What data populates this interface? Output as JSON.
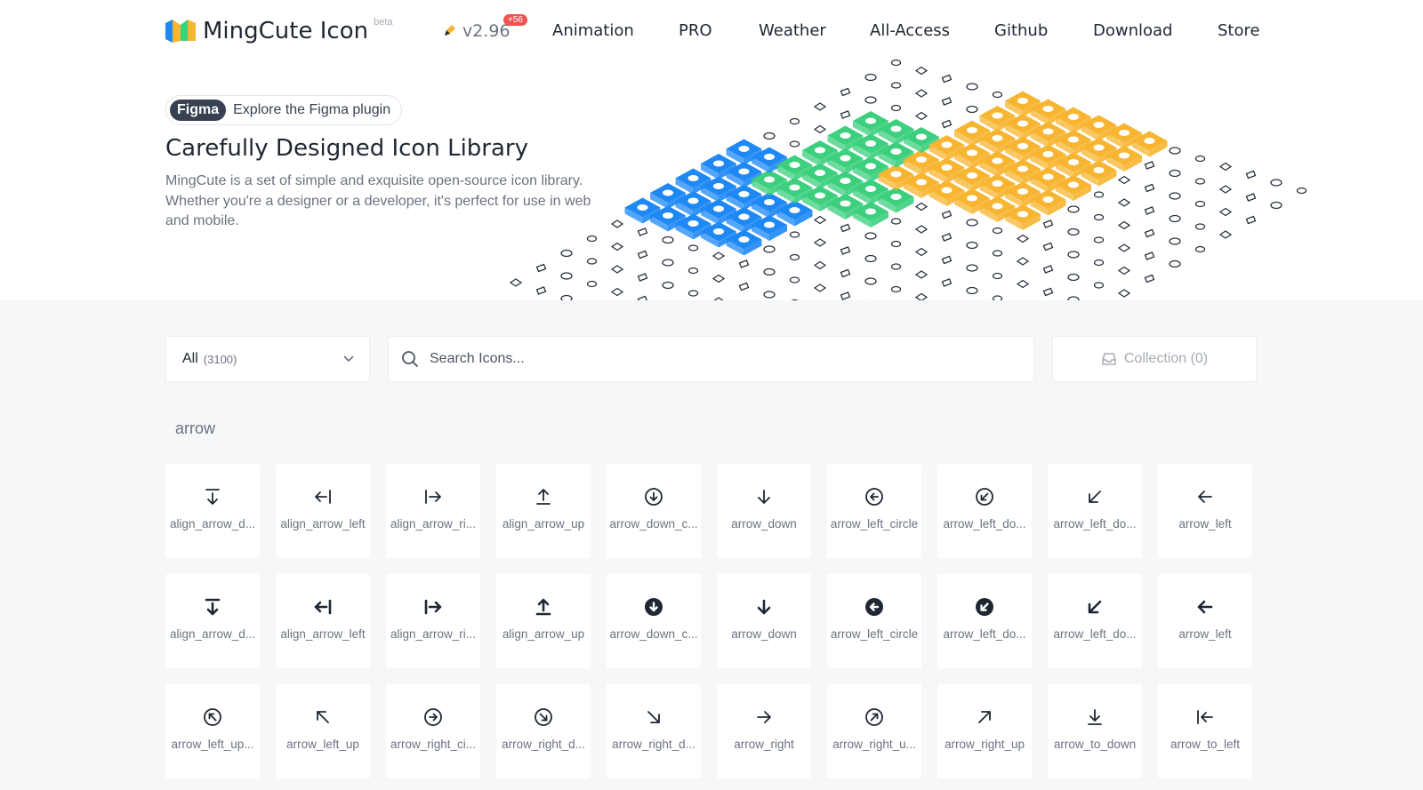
{
  "header": {
    "logo_text": "MingCute Icon",
    "beta": "beta",
    "version": "v2.96",
    "badge": "+56",
    "nav": [
      "Animation",
      "PRO",
      "Weather",
      "All-Access",
      "Github",
      "Download",
      "Store"
    ]
  },
  "hero": {
    "figma_tag": "Figma",
    "figma_text": "Explore the Figma plugin",
    "title": "Carefully Designed Icon Library",
    "description": "MingCute is a set of simple and exquisite open-source icon library. Whether you're a designer or a developer, it's perfect for use in web and mobile."
  },
  "toolbar": {
    "select_label": "All",
    "select_count": "(3100)",
    "search_placeholder": "Search Icons...",
    "collection": "Collection (0)"
  },
  "section": {
    "label": "arrow"
  },
  "icons": [
    {
      "name": "align_arrow_d...",
      "icon": "align-down-icon",
      "filled": false
    },
    {
      "name": "align_arrow_left",
      "icon": "align-left-icon",
      "filled": false
    },
    {
      "name": "align_arrow_ri...",
      "icon": "align-right-icon",
      "filled": false
    },
    {
      "name": "align_arrow_up",
      "icon": "align-up-icon",
      "filled": false
    },
    {
      "name": "arrow_down_c...",
      "icon": "arrow-down-circle-icon",
      "filled": false
    },
    {
      "name": "arrow_down",
      "icon": "arrow-down-icon",
      "filled": false
    },
    {
      "name": "arrow_left_circle",
      "icon": "arrow-left-circle-icon",
      "filled": false
    },
    {
      "name": "arrow_left_do...",
      "icon": "arrow-left-down-circle-icon",
      "filled": false
    },
    {
      "name": "arrow_left_do...",
      "icon": "arrow-left-down-icon",
      "filled": false
    },
    {
      "name": "arrow_left",
      "icon": "arrow-left-icon",
      "filled": false
    },
    {
      "name": "align_arrow_d...",
      "icon": "align-down-icon",
      "filled": true
    },
    {
      "name": "align_arrow_left",
      "icon": "align-left-icon",
      "filled": true
    },
    {
      "name": "align_arrow_ri...",
      "icon": "align-right-icon",
      "filled": true
    },
    {
      "name": "align_arrow_up",
      "icon": "align-up-icon",
      "filled": true
    },
    {
      "name": "arrow_down_c...",
      "icon": "arrow-down-circle-icon",
      "filled": true
    },
    {
      "name": "arrow_down",
      "icon": "arrow-down-icon",
      "filled": true
    },
    {
      "name": "arrow_left_circle",
      "icon": "arrow-left-circle-icon",
      "filled": true
    },
    {
      "name": "arrow_left_do...",
      "icon": "arrow-left-down-circle-icon",
      "filled": true
    },
    {
      "name": "arrow_left_do...",
      "icon": "arrow-left-down-icon",
      "filled": true
    },
    {
      "name": "arrow_left",
      "icon": "arrow-left-icon",
      "filled": true
    },
    {
      "name": "arrow_left_up...",
      "icon": "arrow-left-up-circle-icon",
      "filled": false
    },
    {
      "name": "arrow_left_up",
      "icon": "arrow-left-up-icon",
      "filled": false
    },
    {
      "name": "arrow_right_ci...",
      "icon": "arrow-right-circle-icon",
      "filled": false
    },
    {
      "name": "arrow_right_d...",
      "icon": "arrow-right-down-circle-icon",
      "filled": false
    },
    {
      "name": "arrow_right_d...",
      "icon": "arrow-right-down-icon",
      "filled": false
    },
    {
      "name": "arrow_right",
      "icon": "arrow-right-icon",
      "filled": false
    },
    {
      "name": "arrow_right_u...",
      "icon": "arrow-right-up-circle-icon",
      "filled": false
    },
    {
      "name": "arrow_right_up",
      "icon": "arrow-right-up-icon",
      "filled": false
    },
    {
      "name": "arrow_to_down",
      "icon": "arrow-to-down-icon",
      "filled": false
    },
    {
      "name": "arrow_to_left",
      "icon": "arrow-to-left-icon",
      "filled": false
    }
  ],
  "colors": {
    "text": "#1f2733",
    "muted": "#6b7280",
    "badge": "#ef5350",
    "blue": "#1e88f5",
    "green": "#3ccf7e",
    "orange": "#f7b531",
    "background": "#f6f7f8"
  }
}
